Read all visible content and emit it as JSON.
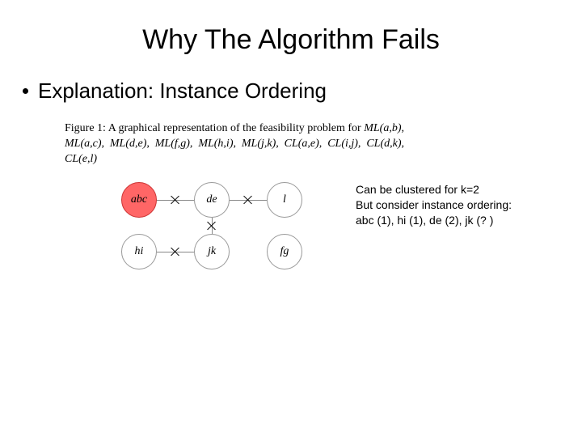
{
  "title": "Why The Algorithm Fails",
  "bullet": "Explanation: Instance Ordering",
  "figure": {
    "lead": "Figure 1: ",
    "body": "A graphical representation of the feasibility problem for ",
    "constraints": "ML(a,b), ML(a,c), ML(d,e), ML(f,g), ML(h,i), ML(j,k), CL(a,e), CL(i,j), CL(d,k), CL(e,l)"
  },
  "diagram": {
    "nodes": [
      {
        "id": "abc",
        "label": "abc",
        "highlighted": true,
        "row": 1,
        "col": 1
      },
      {
        "id": "de",
        "label": "de",
        "highlighted": false,
        "row": 1,
        "col": 2
      },
      {
        "id": "l",
        "label": "l",
        "highlighted": false,
        "row": 1,
        "col": 3
      },
      {
        "id": "hi",
        "label": "hi",
        "highlighted": false,
        "row": 2,
        "col": 1
      },
      {
        "id": "jk",
        "label": "jk",
        "highlighted": false,
        "row": 2,
        "col": 2
      },
      {
        "id": "fg",
        "label": "fg",
        "highlighted": false,
        "row": 2,
        "col": 3
      }
    ],
    "edges": [
      {
        "from": "abc",
        "to": "de",
        "crossed": true
      },
      {
        "from": "de",
        "to": "l",
        "crossed": true
      },
      {
        "from": "de",
        "to": "jk",
        "crossed": true
      },
      {
        "from": "hi",
        "to": "jk",
        "crossed": true
      }
    ]
  },
  "annotation": {
    "line1": "Can be clustered for k=2",
    "line2": "But consider instance ordering:",
    "line3": "abc (1), hi (1), de (2), jk (? )"
  }
}
